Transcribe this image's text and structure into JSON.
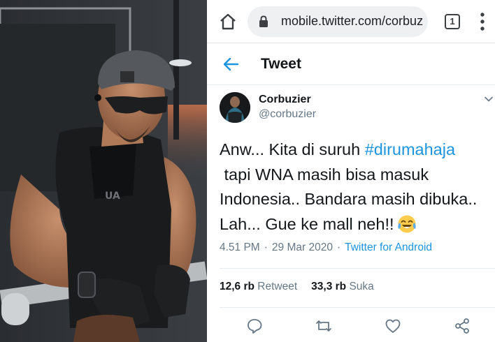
{
  "browser": {
    "url": "mobile.twitter.com/corbuzier",
    "tab_count": "1"
  },
  "header": {
    "title": "Tweet"
  },
  "tweet": {
    "display_name": "Corbuzier",
    "handle": "@corbuzier",
    "text_part1": "Anw... Kita di suruh ",
    "hashtag": "#dirumahaja",
    "text_part2": "\n tapi WNA masih bisa masuk\nIndonesia.. Bandara masih dibuka..\nLah... Gue ke mall neh!!",
    "time": "4.51 PM",
    "separator": "·",
    "date": "29 Mar 2020",
    "source": "Twitter for Android",
    "retweets_count": "12,6 rb",
    "retweets_label": "Retweet",
    "likes_count": "33,3 rb",
    "likes_label": "Suka"
  },
  "icons": {
    "home": "home-icon",
    "lock": "lock-icon",
    "menu": "more-vertical-icon",
    "back": "arrow-left-icon",
    "caret": "chevron-down-icon",
    "emoji": "tears-of-joy-emoji",
    "reply": "reply-icon",
    "retweet": "retweet-icon",
    "like": "heart-icon",
    "share": "share-icon"
  },
  "colors": {
    "twitter_blue": "#1b95e0",
    "text_primary": "#14171a",
    "text_secondary": "#657786"
  }
}
